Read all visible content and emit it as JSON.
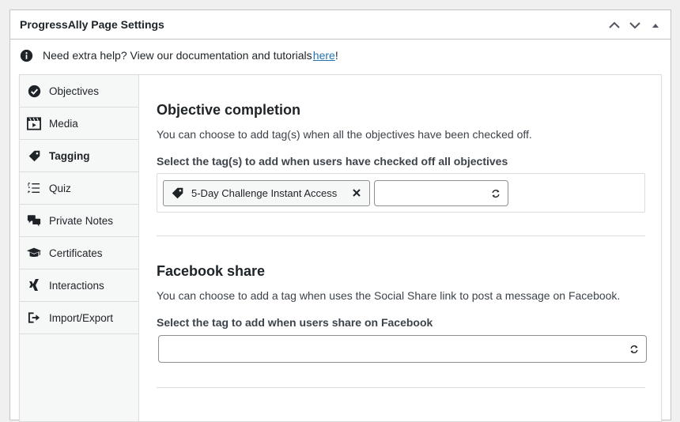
{
  "metabox": {
    "title": "ProgressAlly Page Settings",
    "controls": [
      "move-up",
      "move-down",
      "toggle-collapse"
    ]
  },
  "help": {
    "text": "Need extra help? View our documentation and tutorials ",
    "link": "here",
    "suffix": "!"
  },
  "sidebar": {
    "items": [
      {
        "label": "Objectives",
        "icon": "check-circle-icon"
      },
      {
        "label": "Media",
        "icon": "film-icon"
      },
      {
        "label": "Tagging",
        "icon": "tag-icon",
        "active": true
      },
      {
        "label": "Quiz",
        "icon": "list-icon"
      },
      {
        "label": "Private Notes",
        "icon": "comments-icon"
      },
      {
        "label": "Certificates",
        "icon": "graduation-cap-icon"
      },
      {
        "label": "Interactions",
        "icon": "xing-icon"
      },
      {
        "label": "Import/Export",
        "icon": "sign-out-icon"
      }
    ]
  },
  "objective_completion": {
    "title": "Objective completion",
    "description": "You can choose to add tag(s) when all the objectives have been checked off.",
    "label": "Select the tag(s) to add when users have checked off all objectives",
    "selected_tags": [
      "5-Day Challenge Instant Access"
    ],
    "select_value": ""
  },
  "facebook_share": {
    "title": "Facebook share",
    "description": "You can choose to add a tag when uses the Social Share link to post a message on Facebook.",
    "label": "Select the tag to add when users share on Facebook",
    "select_value": ""
  }
}
